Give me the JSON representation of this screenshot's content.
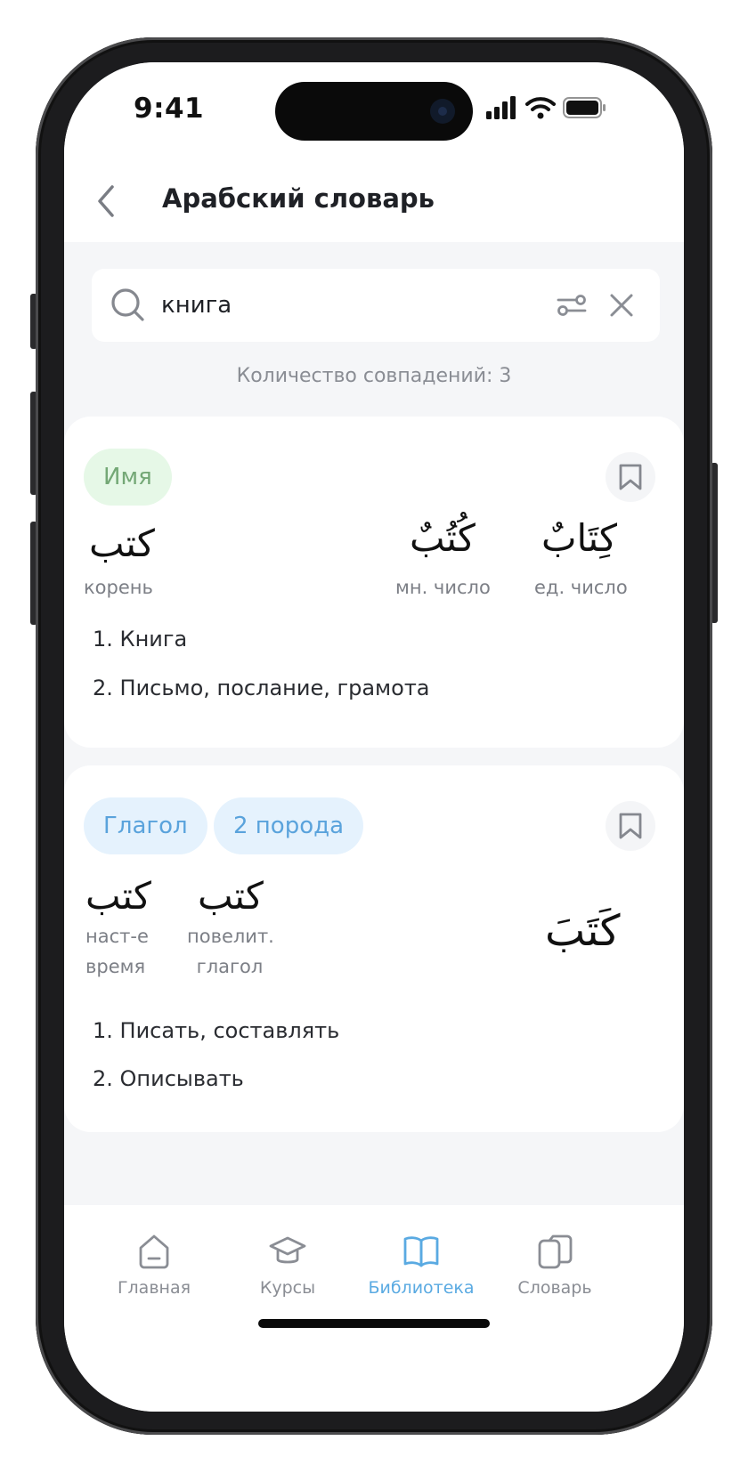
{
  "status_bar": {
    "time": "9:41"
  },
  "header": {
    "title": "Арабский словарь"
  },
  "search": {
    "value": "книга",
    "placeholder": ""
  },
  "results": {
    "matches_label": "Количество совпадений: 3"
  },
  "cards": [
    {
      "tags": [
        "Имя"
      ],
      "forms": [
        {
          "word": "كتب",
          "label": "корень"
        },
        {
          "word": "كُتُبٌ",
          "label": "мн. число"
        },
        {
          "word": "كِتَابٌ",
          "label": "ед. число"
        }
      ],
      "meanings": [
        "1. Книга",
        "2. Письмо, послание, грамота"
      ]
    },
    {
      "tags": [
        "Глагол",
        "2 порода"
      ],
      "forms": [
        {
          "word": "كتب",
          "label_line1": "наст-е",
          "label_line2": "время"
        },
        {
          "word": "كتب",
          "label_line1": "повелит.",
          "label_line2": "глагол"
        }
      ],
      "main_word": "كَتَبَ",
      "meanings": [
        "1. Писать, составлять",
        "2. Описывать"
      ]
    }
  ],
  "tabbar": {
    "items": [
      {
        "label": "Главная",
        "icon": "home-icon"
      },
      {
        "label": "Курсы",
        "icon": "graduation-cap-icon"
      },
      {
        "label": "Библиотека",
        "icon": "book-icon",
        "active": true
      },
      {
        "label": "Словарь",
        "icon": "cards-icon"
      }
    ]
  },
  "colors": {
    "accent": "#5aaae2",
    "tag_green_bg": "#e6f8e7",
    "tag_green_text": "#74a876",
    "tag_blue_bg": "#e5f2fd",
    "tag_blue_text": "#5aa3dc"
  }
}
